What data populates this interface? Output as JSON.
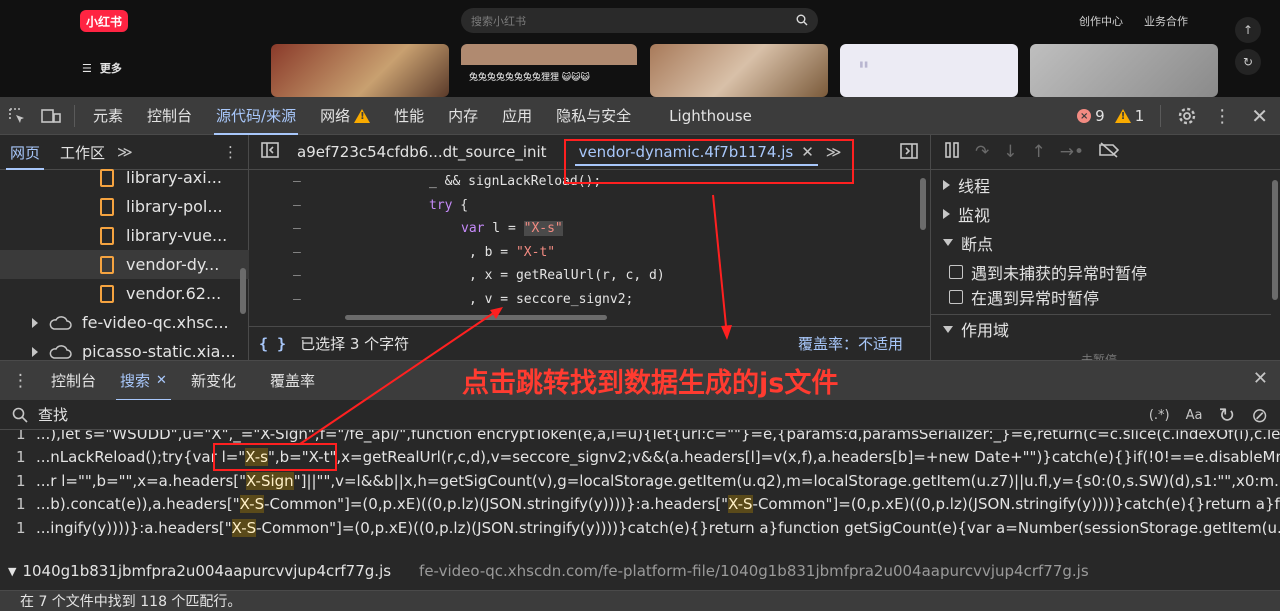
{
  "webpage": {
    "logo": "小红书",
    "search_placeholder": "搜索小红书",
    "links": [
      "创作中心",
      "业务合作"
    ],
    "more_label": "更多",
    "card_caption": "兔兔兔兔兔兔兔兔狸狸 😺😺😺"
  },
  "toolbar": {
    "tabs": [
      "元素",
      "控制台",
      "源代码/来源",
      "网络",
      "性能",
      "内存",
      "应用",
      "隐私与安全",
      "Lighthouse"
    ],
    "active_tab": "源代码/来源",
    "errors": "9",
    "warnings": "1"
  },
  "navigator": {
    "tabs": [
      "网页",
      "工作区"
    ],
    "files": [
      "library-axi...",
      "library-pol...",
      "library-vue...",
      "vendor-dy...",
      "vendor.62..."
    ],
    "domains": [
      "fe-video-qc.xhsc...",
      "picasso-static.xia..."
    ]
  },
  "editor": {
    "tabs": [
      "a9ef723c54cfdb6...dt_source_init",
      "vendor-dynamic.4f7b1174.js"
    ],
    "code_lines": [
      {
        "gutter": "–",
        "text": "_ && signLackReload();"
      },
      {
        "gutter": "–",
        "kw": "try",
        "text": " {"
      },
      {
        "gutter": "–",
        "kw": "var",
        "text": " l = ",
        "str": "\"X-s\""
      },
      {
        "gutter": "–",
        "text": ", b = ",
        "str": "\"X-t\""
      },
      {
        "gutter": "–",
        "text": ", x = getRealUrl(r, c, d)"
      },
      {
        "gutter": "–",
        "text": ", v = seccore_signv2;"
      }
    ],
    "status": "已选择 3 个字符",
    "coverage": "覆盖率：不适用"
  },
  "debugger": {
    "sections": [
      "线程",
      "监视",
      "断点",
      "作用域"
    ],
    "checkboxes": [
      "遇到未捕获的异常时暂停",
      "在遇到异常时暂停"
    ],
    "paused_text": "未暂停"
  },
  "drawer": {
    "tabs": [
      "控制台",
      "搜索",
      "新变化",
      "覆盖率"
    ],
    "active_tab": "搜索",
    "annotation": "点击跳转找到数据生成的js文件"
  },
  "search": {
    "label": "查找",
    "regex": "(.*)",
    "case": "Aa",
    "results": [
      {
        "line": "1",
        "parts": [
          [
            "...),let s=\"WSUDD\",u=\"X\",_=\"X-Sign\",f=\"/fe_api/\",function encryptToken(e,a,i=u){let{url:c=\"\"}=e,{params:d,paramsSerializer:_}=e,return(c=c.slice(c.indexOf(i),c.le...",
            false
          ]
        ]
      },
      {
        "line": "1",
        "parts": [
          [
            "...nLackReload();try{var ",
            false
          ],
          [
            "l=\"",
            false
          ],
          [
            "X-s",
            true
          ],
          [
            "\",b=\"X-t\"",
            false
          ],
          [
            ",x=getRealUrl(r,c,d),v=seccore_signv2;v&&(a.headers[l]=v(x,f),a.headers[b]=+new Date+\"\")}catch(e){}if(!0!==e.disableMn...",
            false
          ]
        ]
      },
      {
        "line": "1",
        "parts": [
          [
            "...r l=\"\",b=\"\",x=a.headers[\"",
            false
          ],
          [
            "X-Sign",
            true
          ],
          [
            "\"]||\"\",v=l&&b||x,h=getSigCount(v),g=localStorage.getItem(u.q2),m=localStorage.getItem(u.z7)||u.fl,y={s0:(0,s.SW)(d),s1:\"\",x0:m...",
            false
          ]
        ]
      },
      {
        "line": "1",
        "parts": [
          [
            "...b).concat(e)),a.headers[\"",
            false
          ],
          [
            "X-S",
            true
          ],
          [
            "-Common\"]=(0,p.xE)((0,p.lz)(JSON.stringify(y))))}:a.headers[\"",
            false
          ],
          [
            "X-S",
            true
          ],
          [
            "-Common\"]=(0,p.xE)((0,p.lz)(JSON.stringify(y))))}catch(e){}return a}f...",
            false
          ]
        ]
      },
      {
        "line": "1",
        "parts": [
          [
            "...ingify(y))))}:a.headers[\"",
            false
          ],
          [
            "X-S",
            true
          ],
          [
            "-Common\"]=(0,p.xE)((0,p.lz)(JSON.stringify(y))))}catch(e){}return a}function getSigCount(e){var a=Number(sessionStorage.getItem(u...",
            false
          ]
        ]
      }
    ],
    "file_name": "1040g1b831jbmfpra2u004aapurcvvjup4crf77g.js",
    "file_url": "fe-video-qc.xhscdn.com/fe-platform-file/1040g1b831jbmfpra2u004aapurcvvjup4crf77g.js",
    "summary": "在 7 个文件中找到 118 个匹配行。"
  },
  "colors": {
    "accent": "#a8c7fa",
    "annotation": "#ff2020",
    "match": "#5a4a1a"
  }
}
